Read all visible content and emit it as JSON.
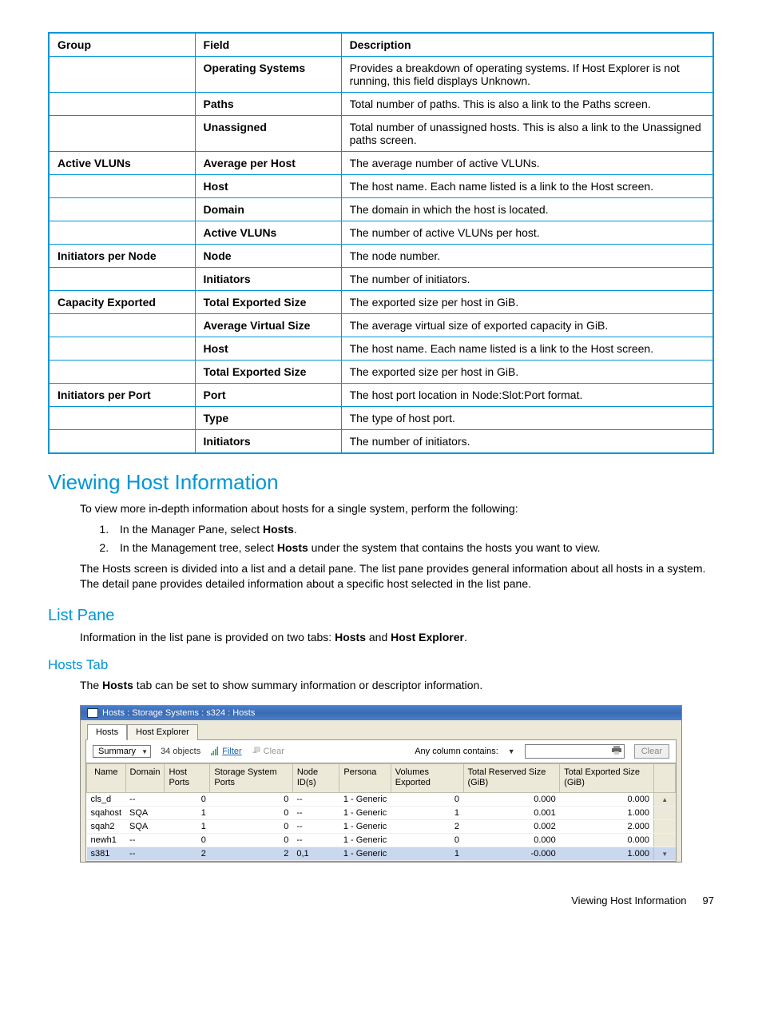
{
  "doc_table": {
    "headers": [
      "Group",
      "Field",
      "Description"
    ],
    "rows": [
      {
        "group": "",
        "field": "Operating Systems",
        "desc": "Provides a breakdown of operating systems. If Host Explorer is not running, this field displays Unknown."
      },
      {
        "group": "",
        "field": "Paths",
        "desc": "Total number of paths. This is also a link to the Paths screen."
      },
      {
        "group": "",
        "field": "Unassigned",
        "desc": "Total number of unassigned hosts. This is also a link to the Unassigned paths screen."
      },
      {
        "group": "Active VLUNs",
        "field": "Average per Host",
        "desc": "The average number of active VLUNs."
      },
      {
        "group": "",
        "field": "Host",
        "desc": "The host name. Each name listed is a link to the Host screen."
      },
      {
        "group": "",
        "field": "Domain",
        "desc": "The domain in which the host is located."
      },
      {
        "group": "",
        "field": "Active VLUNs",
        "desc": "The number of active VLUNs per host."
      },
      {
        "group": "Initiators per Node",
        "field": "Node",
        "desc": "The node number."
      },
      {
        "group": "",
        "field": "Initiators",
        "desc": "The number of initiators."
      },
      {
        "group": "Capacity Exported",
        "field": "Total Exported Size",
        "desc": "The exported size per host in GiB."
      },
      {
        "group": "",
        "field": "Average Virtual Size",
        "desc": "The average virtual size of exported capacity in GiB."
      },
      {
        "group": "",
        "field": "Host",
        "desc": "The host name. Each name listed is a link to the Host screen."
      },
      {
        "group": "",
        "field": "Total Exported Size",
        "desc": "The exported size per host in GiB."
      },
      {
        "group": "Initiators per Port",
        "field": "Port",
        "desc": "The host port location in Node:Slot:Port format."
      },
      {
        "group": "",
        "field": "Type",
        "desc": "The type of host port."
      },
      {
        "group": "",
        "field": "Initiators",
        "desc": "The number of initiators."
      }
    ]
  },
  "heading_viewing": "Viewing Host Information",
  "intro_para": "To view more in-depth information about hosts for a single system, perform the following:",
  "step1_pre": "In the Manager Pane, select ",
  "step1_bold": "Hosts",
  "step1_post": ".",
  "step2_pre": "In the Management tree, select ",
  "step2_bold": "Hosts",
  "step2_post": " under the system that contains the hosts you want to view.",
  "hosts_screen_para": "The Hosts screen is divided into a list and a detail pane. The list pane provides general information about all hosts in a system. The detail pane provides detailed information about a specific host selected in the list pane.",
  "heading_listpane": "List Pane",
  "listpane_para_pre": "Information in the list pane is provided on two tabs: ",
  "listpane_bold1": "Hosts",
  "listpane_mid": " and ",
  "listpane_bold2": "Host Explorer",
  "listpane_post": ".",
  "heading_hoststab": "Hosts Tab",
  "hoststab_para_pre": "The ",
  "hoststab_bold": "Hosts",
  "hoststab_para_post": " tab can be set to show summary information or descriptor information.",
  "figure": {
    "titlebar": "Hosts : Storage Systems : s324 : Hosts",
    "tab_hosts": "Hosts",
    "tab_hostexplorer": "Host Explorer",
    "view_select": "Summary",
    "object_count": "34 objects",
    "filter_label": "Filter",
    "clear_label": "Clear",
    "anycol_label": "Any column contains:",
    "clear_btn": "Clear",
    "columns": [
      "Name",
      "Domain",
      "Host Ports",
      "Storage System Ports",
      "Node ID(s)",
      "Persona",
      "Volumes Exported",
      "Total Reserved Size (GiB)",
      "Total Exported Size (GiB)"
    ],
    "rows": [
      {
        "name": "cls_d",
        "domain": "--",
        "hostports": "0",
        "ssp": "0",
        "nodeids": "--",
        "persona": "1 - Generic",
        "vexp": "0",
        "tres": "0.000",
        "texp": "0.000",
        "selected": false
      },
      {
        "name": "sqahost",
        "domain": "SQA",
        "hostports": "1",
        "ssp": "0",
        "nodeids": "--",
        "persona": "1 - Generic",
        "vexp": "1",
        "tres": "0.001",
        "texp": "1.000",
        "selected": false
      },
      {
        "name": "sqah2",
        "domain": "SQA",
        "hostports": "1",
        "ssp": "0",
        "nodeids": "--",
        "persona": "1 - Generic",
        "vexp": "2",
        "tres": "0.002",
        "texp": "2.000",
        "selected": false
      },
      {
        "name": "newh1",
        "domain": "--",
        "hostports": "0",
        "ssp": "0",
        "nodeids": "--",
        "persona": "1 - Generic",
        "vexp": "0",
        "tres": "0.000",
        "texp": "0.000",
        "selected": false
      },
      {
        "name": "s381",
        "domain": "--",
        "hostports": "2",
        "ssp": "2",
        "nodeids": "0,1",
        "persona": "1 - Generic",
        "vexp": "1",
        "tres": "-0.000",
        "texp": "1.000",
        "selected": true
      }
    ]
  },
  "footer_text": "Viewing Host Information",
  "footer_page": "97"
}
